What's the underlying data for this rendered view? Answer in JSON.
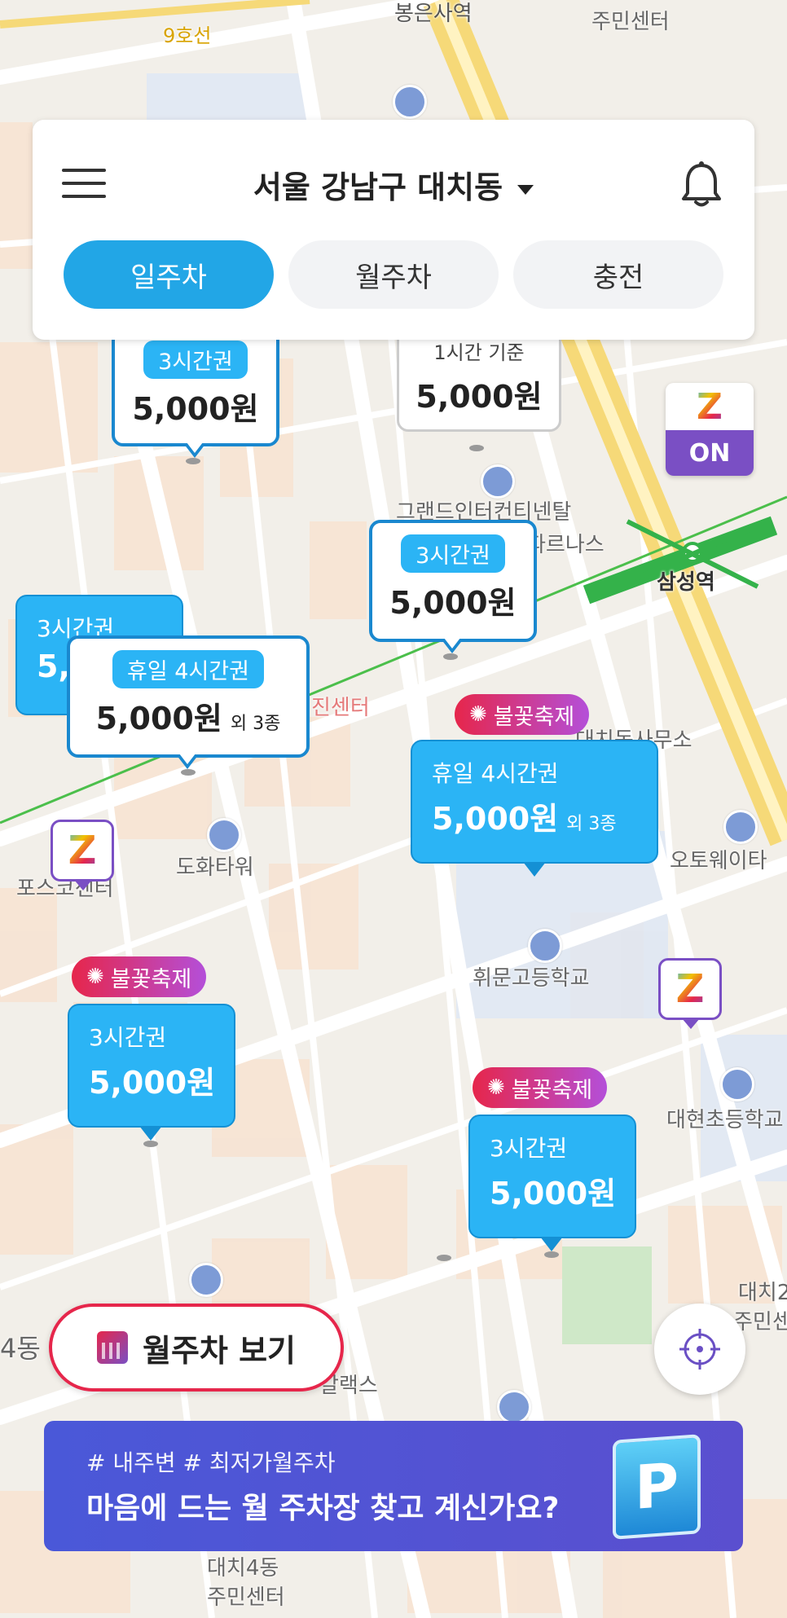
{
  "header": {
    "location": "서울 강남구 대치동",
    "tabs": [
      {
        "label": "일주차",
        "active": true
      },
      {
        "label": "월주차",
        "active": false
      },
      {
        "label": "충전",
        "active": false
      }
    ]
  },
  "map_labels": {
    "line9": "9호선",
    "station_top": "봉은사역",
    "center_top": "주민센터",
    "grand_intercontinental": "그랜드인터컨티넨탈",
    "grand_inter_sub": "파르나스",
    "samsung_station": "삼성역",
    "center_left": "진센터",
    "daechi_office": "대치동사무소",
    "dowha_tower": "도화타워",
    "posco_center": "포스코센터",
    "oto_way": "오토웨이타",
    "hwimun_high": "휘문고등학교",
    "daehyun_elem": "대현초등학교",
    "daechi2": "대치2",
    "daechi2_center": "주민센",
    "daechi4": "대치4동",
    "daechi4_center": "주민센터",
    "neighborhood": "4동",
    "galaxy": "갈랙스"
  },
  "markers": [
    {
      "tag": "3시간권",
      "price": "5,000원"
    },
    {
      "tag": "1시간 기준",
      "price": "5,000원"
    },
    {
      "tag": "3시간권",
      "price": "5,000원"
    },
    {
      "tag": "3시간권",
      "price": "5,"
    },
    {
      "tag": "휴일 4시간권",
      "price": "5,000원",
      "extra": "외 3종"
    },
    {
      "tag": "휴일 4시간권",
      "price": "5,000원",
      "extra": "외 3종"
    },
    {
      "tag": "3시간권",
      "price": "5,000원"
    },
    {
      "tag": "3시간권",
      "price": "5,000원"
    }
  ],
  "festival_label": "불꽃축제",
  "zoomy_on": "ON",
  "zoomy_logo": "Z",
  "monthly_button": "월주차 보기",
  "banner": {
    "tags": "# 내주변  # 최저가월주차",
    "headline": "마음에 드는 월 주차장 찾고 계신가요?",
    "parking_sign": "P"
  },
  "colors": {
    "accent": "#22a6e6",
    "marker_blue": "#2bb4f5",
    "festival_start": "#e6264b",
    "festival_end": "#b44fd9",
    "zoomy_purple": "#7a4fc4",
    "banner": "#4a58d8"
  }
}
